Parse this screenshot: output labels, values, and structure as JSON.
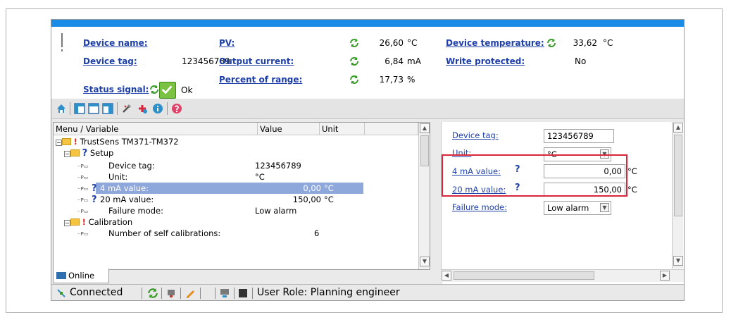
{
  "header": {
    "device_name_label": "Device name:",
    "device_tag_label": "Device tag:",
    "device_tag_value": "123456789",
    "status_signal_label": "Status signal:",
    "status_value": "Ok",
    "pv_label": "PV:",
    "pv_value": "26,60",
    "pv_unit": "°C",
    "output_current_label": "Output current:",
    "output_current_value": "6,84",
    "output_current_unit": "mA",
    "percent_range_label": "Percent of range:",
    "percent_range_value": "17,73",
    "percent_range_unit": "%",
    "device_temp_label": "Device temperature:",
    "device_temp_value": "33,62",
    "device_temp_unit": "°C",
    "write_protected_label": "Write protected:",
    "write_protected_value": "No"
  },
  "toolbar": {
    "icons": [
      "home-icon",
      "view-layout-1-icon",
      "view-layout-2-icon",
      "view-layout-3-icon",
      "tools-icon",
      "add-icon",
      "info-icon",
      "help-icon"
    ]
  },
  "tree": {
    "columns": {
      "menu": "Menu / Variable",
      "value": "Value",
      "unit": "Unit"
    },
    "root": "TrustSens TM371-TM372",
    "setup": "Setup",
    "rows": [
      {
        "label": "Device tag:",
        "value": "123456789",
        "unit": ""
      },
      {
        "label": "Unit:",
        "value": "°C",
        "unit": ""
      },
      {
        "label": "4 mA value:",
        "value": "0,00",
        "unit": "°C"
      },
      {
        "label": "20 mA value:",
        "value": "150,00",
        "unit": "°C"
      },
      {
        "label": "Failure mode:",
        "value": "Low alarm",
        "unit": ""
      }
    ],
    "calibration": "Calibration",
    "calib_row": {
      "label": "Number of self calibrations:",
      "value": "6"
    }
  },
  "tab": {
    "label": "Online"
  },
  "right": {
    "device_tag_label": "Device tag:",
    "device_tag_value": "123456789",
    "unit_label": "Unit:",
    "unit_value": "°C",
    "ma4_label": "4 mA value:",
    "ma4_value": "0,00",
    "ma4_unit": "°C",
    "ma20_label": "20 mA value:",
    "ma20_value": "150,00",
    "ma20_unit": "°C",
    "failure_label": "Failure mode:",
    "failure_value": "Low alarm"
  },
  "status": {
    "connected": "Connected",
    "role": "User Role: Planning engineer"
  },
  "colors": {
    "accent": "#1a8ce6",
    "link": "#1e3fa8",
    "highlight": "#d9263a",
    "selection": "#8fa8dc"
  }
}
